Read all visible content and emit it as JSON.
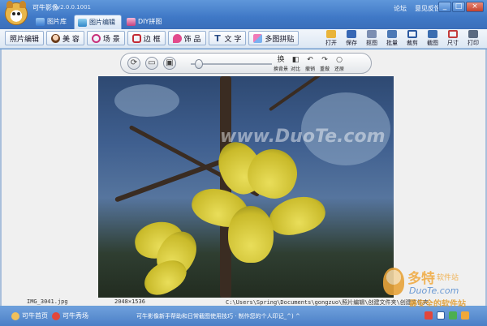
{
  "app": {
    "title": "可牛影像",
    "version": "v2.0.0.1001"
  },
  "app_tabs": [
    {
      "label": "图片库",
      "active": false
    },
    {
      "label": "图片编辑",
      "active": true
    },
    {
      "label": "DIY拼图",
      "active": false
    }
  ],
  "top_links": {
    "forum": "论坛",
    "feedback": "意见反馈"
  },
  "window_controls": {
    "minimize": "_",
    "maximize": "□",
    "close": "×"
  },
  "tools": [
    {
      "label": "照片编辑",
      "icon": "photo-edit-icon"
    },
    {
      "label": "美 容",
      "icon": "beauty-face-icon"
    },
    {
      "label": "场 景",
      "icon": "scene-icon"
    },
    {
      "label": "边 框",
      "icon": "border-frame-icon"
    },
    {
      "label": "饰 品",
      "icon": "decoration-icon"
    },
    {
      "label": "文 字",
      "icon": "text-icon"
    },
    {
      "label": "多图拼贴",
      "icon": "collage-icon"
    }
  ],
  "actions": [
    {
      "label": "打开",
      "icon": "open-folder-icon"
    },
    {
      "label": "保存",
      "icon": "save-disk-icon"
    },
    {
      "label": "抠图",
      "icon": "cutout-icon"
    },
    {
      "label": "批量",
      "icon": "batch-icon"
    },
    {
      "label": "裁剪",
      "icon": "crop-icon"
    },
    {
      "label": "截图",
      "icon": "screenshot-icon"
    },
    {
      "label": "尺寸",
      "icon": "resize-icon"
    },
    {
      "label": "打印",
      "icon": "printer-icon"
    }
  ],
  "edit_bar": {
    "zoom_position": 0.05,
    "buttons": [
      {
        "label": "换背景",
        "icon": "change-background-icon"
      },
      {
        "label": "对比",
        "icon": "compare-icon"
      },
      {
        "label": "撤销",
        "icon": "undo-icon"
      },
      {
        "label": "重做",
        "icon": "redo-icon"
      },
      {
        "label": "还原",
        "icon": "restore-icon"
      }
    ]
  },
  "image": {
    "watermark": "www.DuoTe.com",
    "file_name": "IMG_3041.jpg",
    "dimensions": "2048×1536",
    "path": "C:\\Users\\Spring\\Documents\\gongzuo\\照片编辑\\创建文件夹\\创建文件夹"
  },
  "site_watermark": {
    "name": "多特",
    "sub": "软件站",
    "url": "DuoTe.com",
    "slogan": "最安全的软件站"
  },
  "statusbar": {
    "home": "可牛首页",
    "show": "可牛秀场",
    "message": "可牛影像新手帮助和日常截图使用技巧 · 制作您的个人印记_^) ^"
  },
  "colors": {
    "title_bar": "#3f78c6",
    "accent": "#4a7fc6",
    "flower": "#e9de5a"
  }
}
